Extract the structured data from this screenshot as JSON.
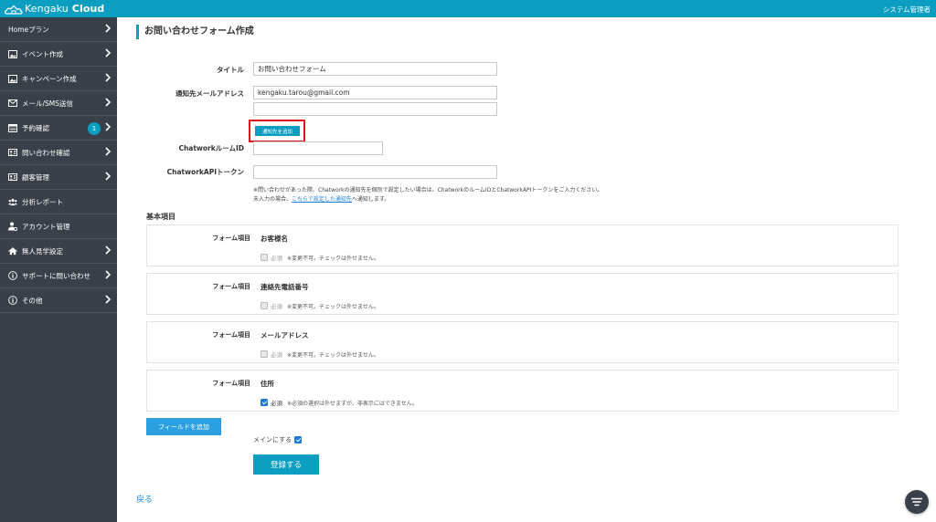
{
  "app": {
    "logo_text": "Kengaku",
    "logo_bold": "Cloud",
    "admin_label": "システム管理者"
  },
  "sidebar": {
    "items": [
      {
        "label": "Homeプラン",
        "icon": "none",
        "chevron": true
      },
      {
        "label": "イベント作成",
        "icon": "image-icon",
        "chevron": true
      },
      {
        "label": "キャンペーン作成",
        "icon": "image-icon",
        "chevron": true
      },
      {
        "label": "メール/SMS送信",
        "icon": "mail-icon",
        "chevron": true
      },
      {
        "label": "予約確認",
        "icon": "calendar-icon",
        "chevron": true,
        "badge": "1"
      },
      {
        "label": "問い合わせ確認",
        "icon": "id-card-icon",
        "chevron": true
      },
      {
        "label": "顧客管理",
        "icon": "id-card-icon",
        "chevron": true
      },
      {
        "label": "分析レポート",
        "icon": "users-icon",
        "chevron": false
      },
      {
        "label": "アカウント管理",
        "icon": "user-cog-icon",
        "chevron": false
      },
      {
        "label": "無人見学設定",
        "icon": "home-icon",
        "chevron": true
      },
      {
        "label": "サポートに問い合わせ",
        "icon": "info-icon",
        "chevron": true
      },
      {
        "label": "その他",
        "icon": "info-icon",
        "chevron": true
      }
    ]
  },
  "page": {
    "title": "お問い合わせフォーム作成"
  },
  "form": {
    "title_label": "タイトル",
    "title_value": "お問い合わせフォーム",
    "email_label": "通知先メールアドレス",
    "email_value": "kengaku.tarou@gmail.com",
    "email_value_2": "",
    "add_notify_button": "通知先を追加",
    "chatwork_room_label": "ChatworkルームID",
    "chatwork_room_value": "",
    "chatwork_token_label": "ChatworkAPIトークン",
    "chatwork_token_value": "",
    "note_line1": "※問い合わせがあった際、Chatworkの通知先を個別で設定したい場合は、ChatworkのルームIDとChatworkAPIトークンをご入力ください。",
    "note_line2_prefix": "未入力の場合、",
    "note_line2_link": "こちらで設定した通知先",
    "note_line2_suffix": "へ通知します。"
  },
  "basic": {
    "section_title": "基本項目",
    "fields": [
      {
        "label": "フォーム項目",
        "name": "お客様名",
        "required_label": "必須",
        "note": "※変更不可。チェックは外せません。",
        "checked": false,
        "disabled": true
      },
      {
        "label": "フォーム項目",
        "name": "連絡先電話番号",
        "required_label": "必須",
        "note": "※変更不可。チェックは外せません。",
        "checked": false,
        "disabled": true
      },
      {
        "label": "フォーム項目",
        "name": "メールアドレス",
        "required_label": "必須",
        "note": "※変更不可。チェックは外せません。",
        "checked": false,
        "disabled": true
      },
      {
        "label": "フォーム項目",
        "name": "住所",
        "required_label": "必須",
        "note": "※必須の選択は外せますが、非表示にはできません。",
        "checked": true,
        "disabled": false
      }
    ]
  },
  "actions": {
    "add_field_button": "フィールドを追加",
    "main_label": "メインにする",
    "main_checked": true,
    "register_button": "登録する",
    "back_link": "戻る"
  }
}
